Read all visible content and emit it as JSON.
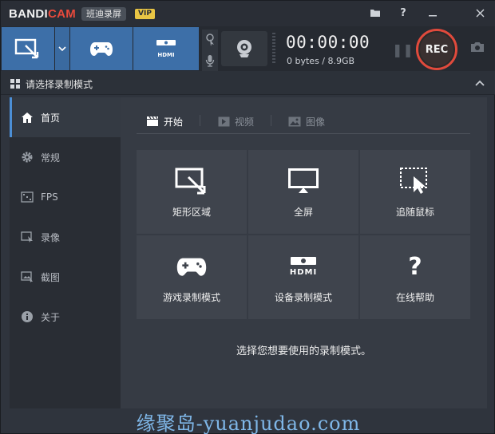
{
  "titlebar": {
    "logo_main": "BANDI",
    "logo_accent": "CAM",
    "app_name": "班迪录屏",
    "vip_badge": "VIP",
    "icons": [
      "folder-icon",
      "help-icon",
      "minimize-icon",
      "close-icon"
    ]
  },
  "toolbar": {
    "modes": [
      {
        "name": "rectangle-mode",
        "icon": "rect-select-icon"
      },
      {
        "name": "mode-dropdown",
        "icon": "chevron-down-icon"
      },
      {
        "name": "game-mode",
        "icon": "gamepad-icon"
      },
      {
        "name": "hdmi-mode",
        "icon": "hdmi-icon",
        "label": "HDMI"
      }
    ],
    "timer": "00:00:00",
    "bytes": "0 bytes / 8.9GB",
    "rec_label": "REC"
  },
  "section": {
    "title": "请选择录制模式"
  },
  "sidebar": {
    "items": [
      {
        "label": "首页",
        "icon": "home-icon",
        "active": true
      },
      {
        "label": "常规",
        "icon": "gear-icon",
        "active": false
      },
      {
        "label": "FPS",
        "icon": "fps-icon",
        "active": false
      },
      {
        "label": "录像",
        "icon": "video-record-icon",
        "active": false
      },
      {
        "label": "截图",
        "icon": "image-capture-icon",
        "active": false
      },
      {
        "label": "关于",
        "icon": "info-icon",
        "active": false
      }
    ]
  },
  "main": {
    "tabs": [
      {
        "label": "开始",
        "icon": "clapper-icon",
        "active": true
      },
      {
        "label": "视频",
        "icon": "play-icon",
        "active": false
      },
      {
        "label": "图像",
        "icon": "picture-icon",
        "active": false
      }
    ],
    "tiles": [
      {
        "label": "矩形区域",
        "icon": "rect-select-icon"
      },
      {
        "label": "全屏",
        "icon": "monitor-icon"
      },
      {
        "label": "追随鼠标",
        "icon": "cursor-follow-icon"
      },
      {
        "label": "游戏录制模式",
        "icon": "gamepad-icon"
      },
      {
        "label": "设备录制模式",
        "icon": "hdmi-icon",
        "icon_text": "HDMI"
      },
      {
        "label": "在线帮助",
        "icon": "question-icon",
        "icon_text": "?"
      }
    ],
    "hint": "选择您想要使用的录制模式。"
  },
  "watermark": "缘聚岛-yuanjudao.com",
  "colors": {
    "accent_blue": "#3d6fa8",
    "rec_red": "#e04a3c",
    "vip_gold": "#e9c544",
    "active_bar": "#4c8fd6"
  }
}
